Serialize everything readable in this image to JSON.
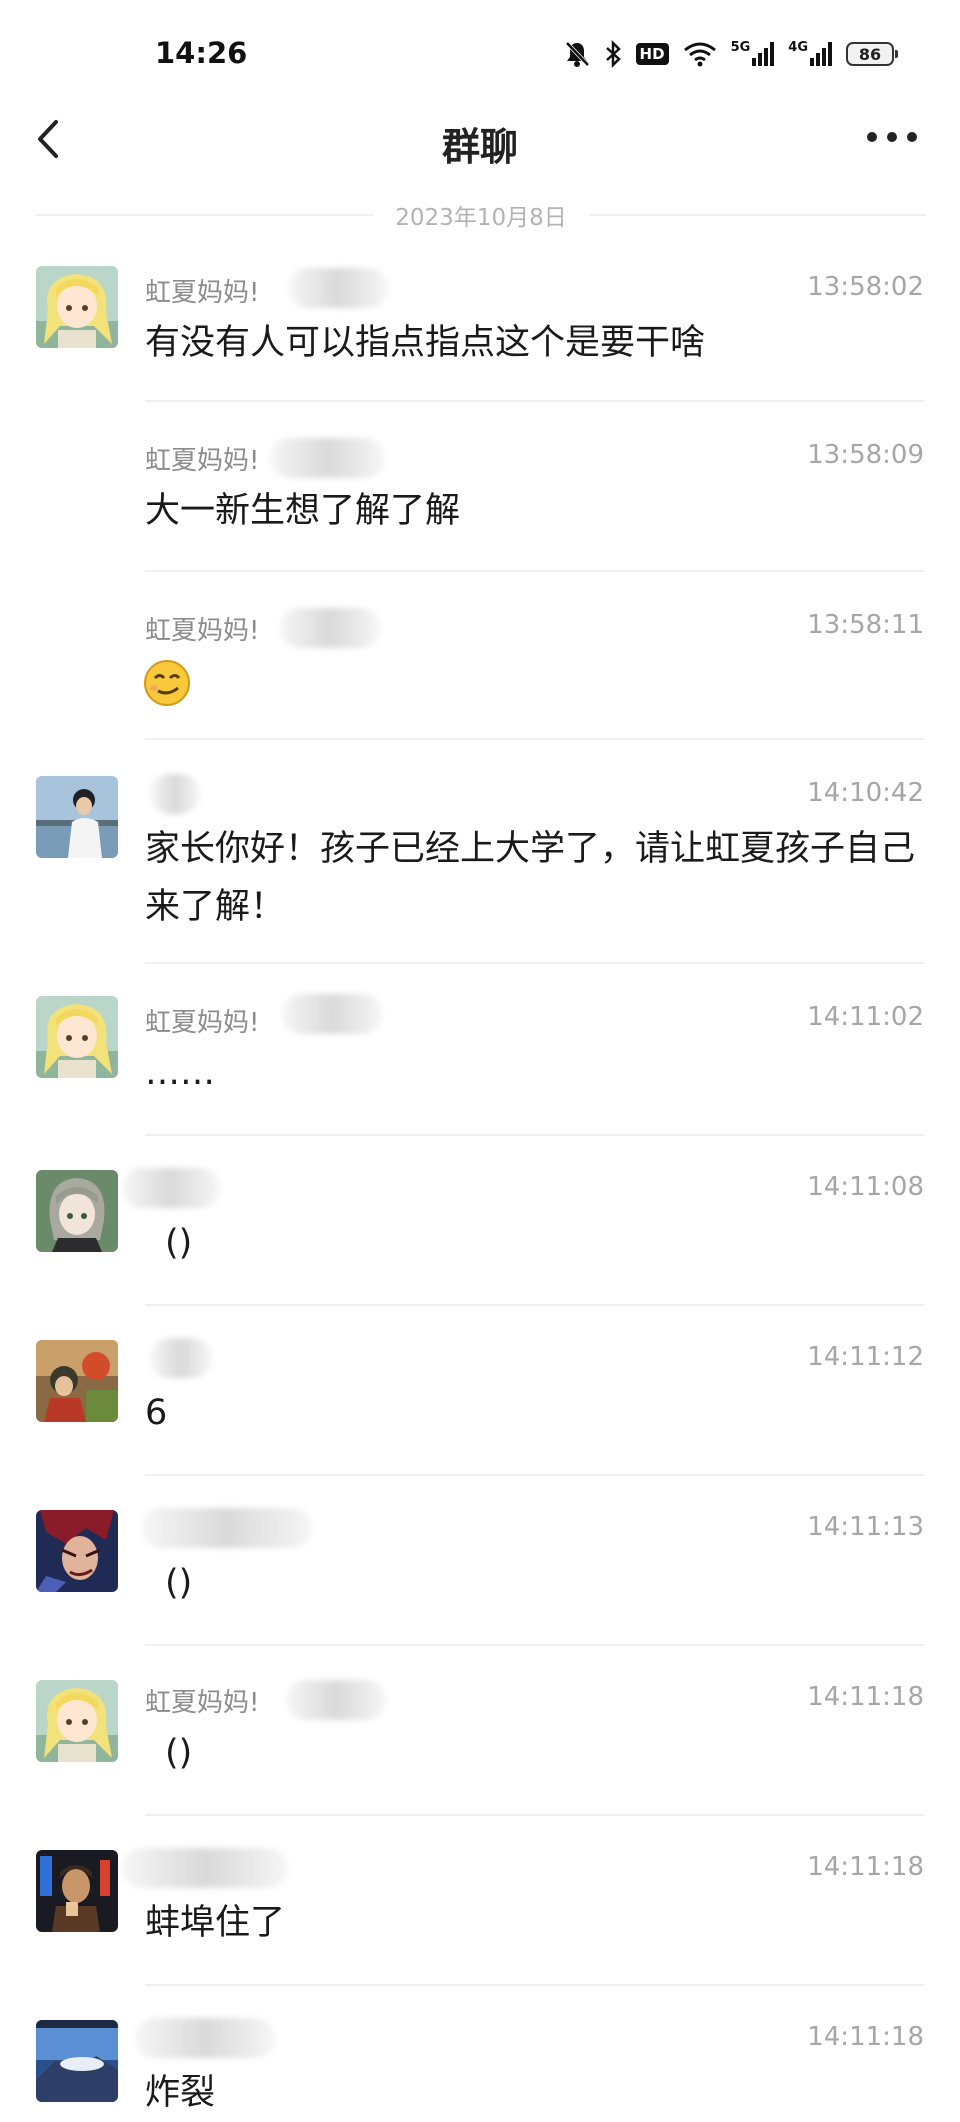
{
  "status_bar": {
    "time": "14:26",
    "hd_label": "HD",
    "net1": "5G",
    "net2": "4G",
    "battery": "86"
  },
  "header": {
    "title": "群聊"
  },
  "date_divider": "2023年10月8日",
  "messages": [
    {
      "sender": "虹夏妈妈!",
      "time": "13:58:02",
      "text": "有没有人可以指点指点这个是要干啥"
    },
    {
      "sender": "虹夏妈妈!",
      "time": "13:58:09",
      "text": "大一新生想了解了解"
    },
    {
      "sender": "虹夏妈妈!",
      "time": "13:58:11",
      "text": ""
    },
    {
      "sender": "",
      "time": "14:10:42",
      "text": "家长你好！孩子已经上大学了，请让虹夏孩子自己来了解！"
    },
    {
      "sender": "虹夏妈妈!",
      "time": "14:11:02",
      "text": "……"
    },
    {
      "sender": "",
      "time": "14:11:08",
      "text": "()"
    },
    {
      "sender": "",
      "time": "14:11:12",
      "text": "6"
    },
    {
      "sender": "",
      "time": "14:11:13",
      "text": "()"
    },
    {
      "sender": "虹夏妈妈!",
      "time": "14:11:18",
      "text": "()"
    },
    {
      "sender": "",
      "time": "14:11:18",
      "text": "蚌埠住了"
    },
    {
      "sender": "",
      "time": "14:11:18",
      "text": "炸裂"
    }
  ],
  "icons": {
    "back": "chevron-left-icon",
    "more": "more-dots-icon",
    "emoji": "smirk-emoji-icon"
  }
}
